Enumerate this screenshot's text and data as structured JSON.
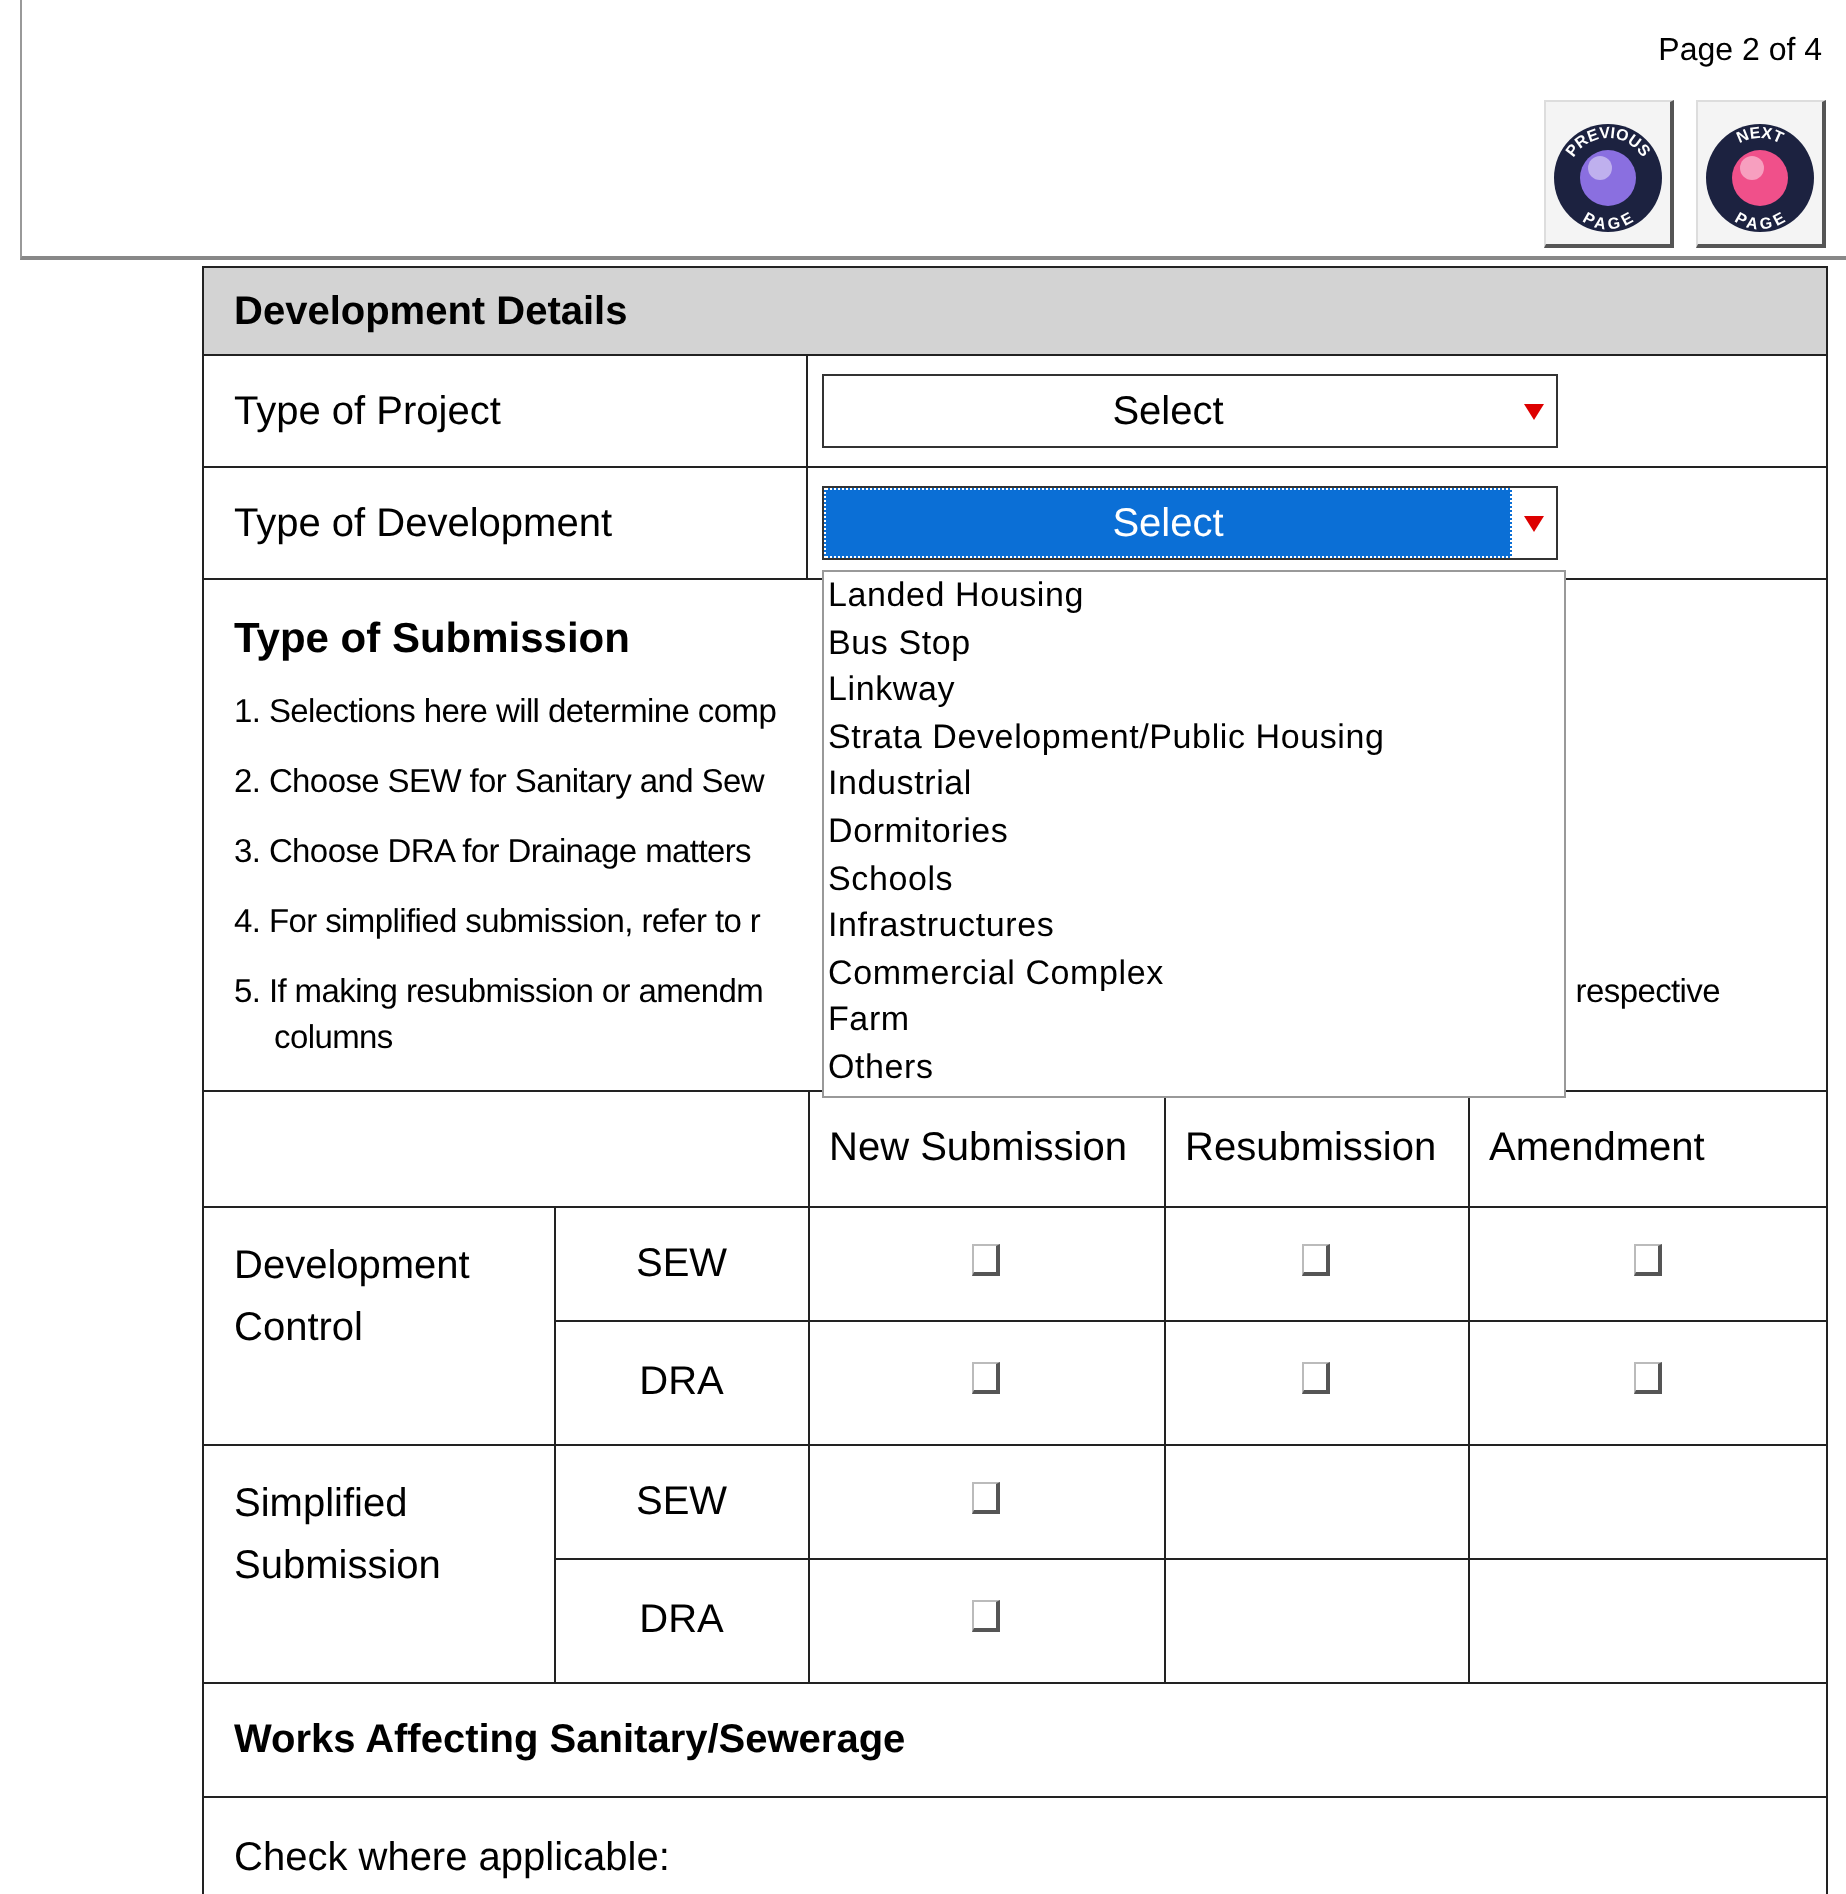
{
  "page_indicator": "Page 2 of 4",
  "nav_buttons": [
    {
      "top": "PREVIOUS",
      "bottom": "PAGE",
      "color": "#8a6fe0"
    },
    {
      "top": "NEXT",
      "bottom": "PAGE",
      "color": "#f0508a"
    }
  ],
  "section_title": "Development Details",
  "fields": [
    {
      "label": "Type of Project",
      "value": "Select",
      "focused": false
    },
    {
      "label": "Type of Development",
      "value": "Select",
      "focused": true
    }
  ],
  "dropdown_options": [
    "Landed Housing",
    "Bus Stop",
    "Linkway",
    "Strata Development/Public Housing",
    "Industrial",
    "Dormitories",
    "Schools",
    "Infrastructures",
    "Commercial Complex",
    "Farm",
    "Others"
  ],
  "submission": {
    "title": "Type of Submission",
    "notes": [
      {
        "text": "1. Selections here will determine comp"
      },
      {
        "text": "2. Choose SEW for Sanitary and Sew"
      },
      {
        "text": "3. Choose DRA for Drainage matters"
      },
      {
        "text": "4. For simplified submission, refer to r"
      },
      {
        "text": "5. If making resubmission or amendm",
        "tail": "respective",
        "continuation": "columns"
      }
    ]
  },
  "submission_table": {
    "columns": [
      "New Submission",
      "Resubmission",
      "Amendment"
    ],
    "groups": [
      {
        "label": "Development Control",
        "rows": [
          {
            "code": "SEW",
            "boxes": [
              {
                "checked": false
              },
              {
                "checked": false
              },
              {
                "checked": false
              }
            ]
          },
          {
            "code": "DRA",
            "boxes": [
              {
                "checked": false
              },
              {
                "checked": false
              },
              {
                "checked": false
              }
            ]
          }
        ]
      },
      {
        "label": "Simplified Submission",
        "rows": [
          {
            "code": "SEW",
            "boxes": [
              {
                "checked": false
              }
            ]
          },
          {
            "code": "DRA",
            "boxes": [
              {
                "checked": false
              }
            ]
          }
        ]
      }
    ]
  },
  "works_title": "Works Affecting Sanitary/Sewerage",
  "works_hint": "Check where applicable:"
}
